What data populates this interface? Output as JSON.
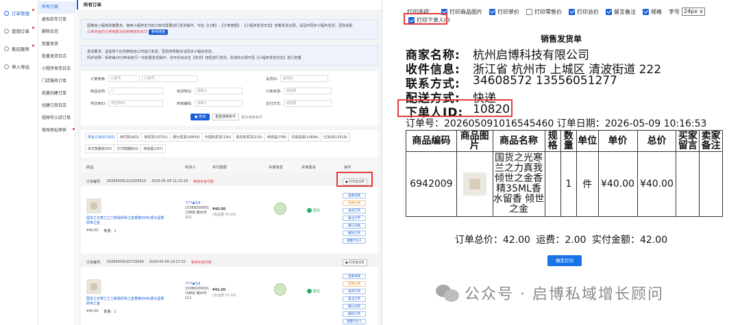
{
  "left": {
    "nav_primary": [
      {
        "label": "订单管理",
        "active": true,
        "dot": true
      },
      {
        "label": "营销订单",
        "active": false,
        "dot": true
      },
      {
        "label": "售后服务",
        "active": false,
        "dot": true
      },
      {
        "label": "导入导出",
        "active": false,
        "dot": false
      }
    ],
    "nav_secondary": [
      {
        "label": "所有订单",
        "active": true,
        "dot": false
      },
      {
        "label": "虚拟库存订单",
        "active": false,
        "dot": false
      },
      {
        "label": "删除日志",
        "active": false,
        "dot": false
      },
      {
        "label": "批量发货",
        "active": false,
        "dot": false
      },
      {
        "label": "批量发货日志",
        "active": false,
        "dot": false
      },
      {
        "label": "小程序发货日志",
        "active": false,
        "dot": false
      },
      {
        "label": "门店服务订单",
        "active": false,
        "dot": false
      },
      {
        "label": "批量创建订单",
        "active": false,
        "dot": false
      },
      {
        "label": "创建订单日志",
        "active": false,
        "dot": false
      },
      {
        "label": "视频号小店订单",
        "active": false,
        "dot": false
      },
      {
        "label": "修改地址审核",
        "active": false,
        "dot": true
      }
    ],
    "page_title": "所有订单",
    "notice1_line1": "因微信小程序政策要求，使用小程序支付的订单均需要进行发货操作，可在【订单】-【订单管理】-【小程序发货日志】查看发货记录。请及时同步小程序发货，否则会影",
    "notice1_line2_red": "订单资金的正常结算及收到微信的处罚",
    "notice1_btn": "参考链接",
    "notice2_line1": "发货要求：请选择下拉列表物流公司进行发货，否则将导致无法同步小程序发货。",
    "notice2_line2": "同步说明：系统每10分钟会执行一次批量发货操作，也可手动点击【发货】按钮进行发货，失败的记录可至【小程序发货日志】进行查看",
    "filters": {
      "order_no_label": "订单搜索:",
      "order_no_select": "订单号",
      "order_no_placeholder": "订单号",
      "member_label": "会员ID:",
      "member_placeholder": "会员ID",
      "goods_label": "商品名称:",
      "receiver_addr_label": "收货地址:",
      "receiver_addr_placeholder": "请输入",
      "source_label": "订单来源:",
      "source_placeholder": "请选择",
      "supplier_label": "供应商ID:",
      "supplier_placeholder": "供应商ID",
      "goods_type_label": "商家编码:",
      "goods_type_placeholder": "请输入",
      "pay_label": "支付方式:",
      "pay_placeholder": "请选择",
      "query_btn": "查询",
      "reset_btn": "重置搜索条件",
      "more_btn": "更多搜索条件"
    },
    "tabs_row1": [
      "所有订单(67002)",
      "待付款(662)",
      "待发货(33701)",
      "部分发货(30854)",
      "代理商发货(190)",
      "供应商发货(210)",
      "待自提(708)",
      "交易完成(14694)",
      "已关闭(13519)"
    ],
    "tabs_row2": [
      "未付款删除(50)",
      "已付款删除(0)",
      "待自提(167)"
    ],
    "table_headers": [
      "商品",
      "收货人",
      "实付金额",
      "买家信息",
      "买家留言",
      "操作"
    ],
    "orders": [
      {
        "order_no_label": "订单编号:",
        "order_no": "20260509112320561​9",
        "time": "2026-05-09 11:23:19",
        "status": "等待买家付款",
        "print_btn": "打印发货单",
        "product_name": "国货之光寒兰之力真我倾世之金香精35ML香水留香 倾世之金",
        "price": "¥40.00",
        "qty": "数量：1",
        "receiver_name": "????◆%8",
        "receiver_phone": "15368209001",
        "receiver_addr": "江西省 赣州市 111",
        "amount": "¥40.00",
        "amount_note": "(含运费 ¥0.00)",
        "buyer_msg": "留言",
        "actions": [
          "查看详情",
          "修改价格",
          "关闭订单",
          "备注订单",
          "确认付款",
          "删除订单",
          "调整代付人"
        ]
      },
      {
        "order_no_label": "订单编号:",
        "order_no": "20260509102733590",
        "time": "2026-05-09 10:27:32",
        "status": "等待买家付款",
        "print_btn": "打印发货单",
        "product_name": "国货之光寒兰之力真我倾世之金香精35ML香水留香 倾世之金",
        "price": "¥40.00",
        "qty": "数量：1",
        "receiver_name": "????◆%8",
        "receiver_phone": "15368209001",
        "receiver_addr": "江西省 赣州市 111",
        "amount": "¥42.00",
        "amount_note": "(含运费 ¥2.00)",
        "buyer_msg": "留言",
        "actions": [
          "查看详情",
          "修改价格",
          "关闭订单",
          "备注订单",
          "确认付款",
          "删除订单",
          "调整代付人"
        ]
      }
    ]
  },
  "right": {
    "options": [
      {
        "label": "打印选项：",
        "checkbox": false
      },
      {
        "label": "打印商品图片",
        "checked": true
      },
      {
        "label": "打印单价",
        "checked": true
      },
      {
        "label": "打印零售价",
        "checked": false
      },
      {
        "label": "打印总价",
        "checked": true
      },
      {
        "label": "留言备注",
        "checked": true
      },
      {
        "label": "规格",
        "checked": true
      }
    ],
    "font_label": "字号",
    "font_value": "24px ∨",
    "buyer_id_option": "打印下单人ID",
    "slip_title": "销售发货单",
    "merchant_label": "商家名称:",
    "merchant_value": "杭州启博科技有限公司",
    "receiver_label": "收件信息:",
    "receiver_value": "浙江省 杭州市 上城区 清波街道 222",
    "contact_label": "联系方式:",
    "contact_value": "34608572 13556051277",
    "delivery_label": "配送方式:",
    "delivery_value": "快递",
    "buyer_id_label": "下单人ID:",
    "buyer_id_value": "10820",
    "order_no_line": "订单号：202605091016545460  订单日期：2026-05-09 10:16:53",
    "table_headers": [
      "商品编码",
      "商品图片",
      "商品名称",
      "规格",
      "数量",
      "单位",
      "单价",
      "总价",
      "买家留言",
      "卖家备注"
    ],
    "row": {
      "code": "6942009",
      "name": "国货之光寒兰之力真我倾世之金香精35ML香水留香 倾世之金",
      "spec": "",
      "qty": "1",
      "unit": "件",
      "unit_price": "¥40.00",
      "total": "¥40.00",
      "buyer_msg": "",
      "seller_note": ""
    },
    "totals": "订单总价：42.00  运费：2.00  实付金额：42.00",
    "confirm_btn": "确定打印",
    "watermark": "公众号 · 启博私域增长顾问"
  }
}
